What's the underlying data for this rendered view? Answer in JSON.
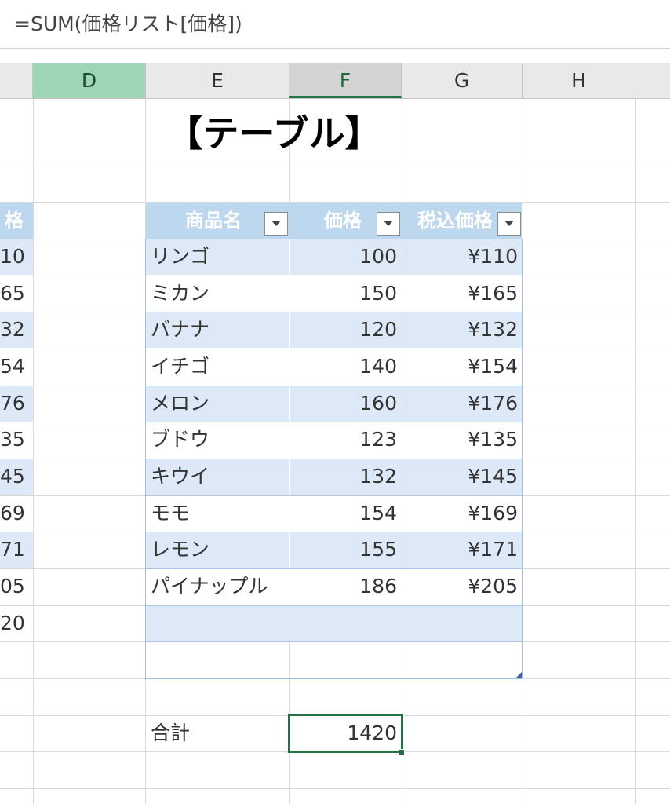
{
  "formula_bar": {
    "text": "=SUM(価格リスト[価格])"
  },
  "columns": [
    {
      "letter": "D",
      "state": "selected"
    },
    {
      "letter": "E",
      "state": "normal"
    },
    {
      "letter": "F",
      "state": "active"
    },
    {
      "letter": "G",
      "state": "normal"
    },
    {
      "letter": "H",
      "state": "normal"
    }
  ],
  "sheet_title": "【テーブル】",
  "offscreen_column": {
    "header": "格",
    "values": [
      "10",
      "65",
      "32",
      "54",
      "76",
      "35",
      "45",
      "69",
      "71",
      "05",
      "20"
    ]
  },
  "table": {
    "headers": {
      "name": "商品名",
      "price": "価格",
      "tax_price": "税込価格"
    },
    "rows": [
      {
        "name": "リンゴ",
        "price": "100",
        "tax_price": "¥110"
      },
      {
        "name": "ミカン",
        "price": "150",
        "tax_price": "¥165"
      },
      {
        "name": "バナナ",
        "price": "120",
        "tax_price": "¥132"
      },
      {
        "name": "イチゴ",
        "price": "140",
        "tax_price": "¥154"
      },
      {
        "name": "メロン",
        "price": "160",
        "tax_price": "¥176"
      },
      {
        "name": "ブドウ",
        "price": "123",
        "tax_price": "¥135"
      },
      {
        "name": "キウイ",
        "price": "132",
        "tax_price": "¥145"
      },
      {
        "name": "モモ",
        "price": "154",
        "tax_price": "¥169"
      },
      {
        "name": "レモン",
        "price": "155",
        "tax_price": "¥171"
      },
      {
        "name": "パイナップル",
        "price": "186",
        "tax_price": "¥205"
      }
    ]
  },
  "total": {
    "label": "合計",
    "value": "1420"
  },
  "colors": {
    "accent": "#217346",
    "table_header": "#bdd7ee",
    "table_band": "#dde9f6",
    "selected_column": "#9fd5b7"
  },
  "icons": {
    "filter": "dropdown-arrow-icon"
  }
}
